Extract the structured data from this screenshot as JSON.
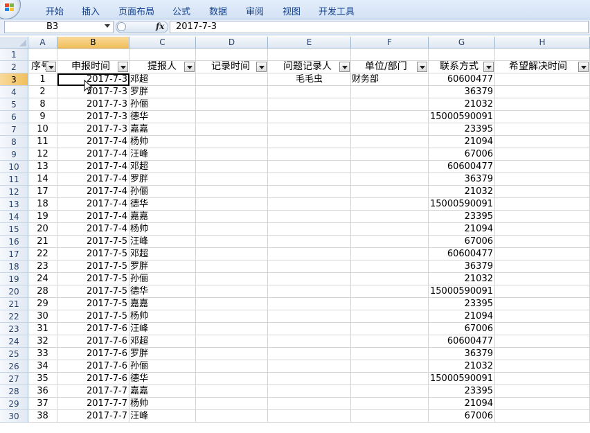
{
  "ribbon": {
    "tabs": [
      "开始",
      "插入",
      "页面布局",
      "公式",
      "数据",
      "审阅",
      "视图",
      "开发工具"
    ]
  },
  "formula_bar": {
    "name_box": "B3",
    "fx_label": "fx",
    "formula": "2017-7-3"
  },
  "columns": [
    "A",
    "B",
    "C",
    "D",
    "E",
    "F",
    "G",
    "H"
  ],
  "header_cells": [
    "序号",
    "申报时间",
    "提报人",
    "记录时间",
    "问题记录人",
    "单位/部门",
    "联系方式",
    "希望解决时间"
  ],
  "row_numbers": [
    "1",
    "2",
    "3",
    "4",
    "5",
    "6",
    "7",
    "8",
    "9",
    "10",
    "11",
    "12",
    "13",
    "14",
    "15",
    "16",
    "17",
    "18",
    "19",
    "20",
    "21",
    "22",
    "23",
    "24",
    "25",
    "26",
    "27",
    "28",
    "29",
    "30"
  ],
  "rows": [
    [
      "1",
      "2017-7-3",
      "邓超",
      "",
      "毛毛虫",
      "财务部",
      "60600477",
      ""
    ],
    [
      "2",
      "2017-7-3",
      "罗胖",
      "",
      "",
      "",
      "36379",
      ""
    ],
    [
      "8",
      "2017-7-3",
      "孙俪",
      "",
      "",
      "",
      "21032",
      ""
    ],
    [
      "9",
      "2017-7-3",
      "德华",
      "",
      "",
      "",
      "15000590091",
      ""
    ],
    [
      "10",
      "2017-7-3",
      "嘉嘉",
      "",
      "",
      "",
      "23395",
      ""
    ],
    [
      "11",
      "2017-7-4",
      "杨帅",
      "",
      "",
      "",
      "21094",
      ""
    ],
    [
      "12",
      "2017-7-4",
      "汪峰",
      "",
      "",
      "",
      "67006",
      ""
    ],
    [
      "13",
      "2017-7-4",
      "邓超",
      "",
      "",
      "",
      "60600477",
      ""
    ],
    [
      "14",
      "2017-7-4",
      "罗胖",
      "",
      "",
      "",
      "36379",
      ""
    ],
    [
      "17",
      "2017-7-4",
      "孙俪",
      "",
      "",
      "",
      "21032",
      ""
    ],
    [
      "18",
      "2017-7-4",
      "德华",
      "",
      "",
      "",
      "15000590091",
      ""
    ],
    [
      "19",
      "2017-7-4",
      "嘉嘉",
      "",
      "",
      "",
      "23395",
      ""
    ],
    [
      "20",
      "2017-7-4",
      "杨帅",
      "",
      "",
      "",
      "21094",
      ""
    ],
    [
      "21",
      "2017-7-5",
      "汪峰",
      "",
      "",
      "",
      "67006",
      ""
    ],
    [
      "22",
      "2017-7-5",
      "邓超",
      "",
      "",
      "",
      "60600477",
      ""
    ],
    [
      "23",
      "2017-7-5",
      "罗胖",
      "",
      "",
      "",
      "36379",
      ""
    ],
    [
      "24",
      "2017-7-5",
      "孙俪",
      "",
      "",
      "",
      "21032",
      ""
    ],
    [
      "28",
      "2017-7-5",
      "德华",
      "",
      "",
      "",
      "15000590091",
      ""
    ],
    [
      "29",
      "2017-7-5",
      "嘉嘉",
      "",
      "",
      "",
      "23395",
      ""
    ],
    [
      "30",
      "2017-7-5",
      "杨帅",
      "",
      "",
      "",
      "21094",
      ""
    ],
    [
      "31",
      "2017-7-6",
      "汪峰",
      "",
      "",
      "",
      "67006",
      ""
    ],
    [
      "32",
      "2017-7-6",
      "邓超",
      "",
      "",
      "",
      "60600477",
      ""
    ],
    [
      "33",
      "2017-7-6",
      "罗胖",
      "",
      "",
      "",
      "36379",
      ""
    ],
    [
      "34",
      "2017-7-6",
      "孙俪",
      "",
      "",
      "",
      "21032",
      ""
    ],
    [
      "35",
      "2017-7-6",
      "德华",
      "",
      "",
      "",
      "15000590091",
      ""
    ],
    [
      "36",
      "2017-7-7",
      "嘉嘉",
      "",
      "",
      "",
      "23395",
      ""
    ],
    [
      "37",
      "2017-7-7",
      "杨帅",
      "",
      "",
      "",
      "21094",
      ""
    ],
    [
      "38",
      "2017-7-7",
      "汪峰",
      "",
      "",
      "",
      "67006",
      ""
    ]
  ],
  "active_cell": "B3",
  "colors": {
    "ribbon_text": "#15428b",
    "selected_header": "#f1c05c",
    "grid_line": "#d4d4d4"
  }
}
